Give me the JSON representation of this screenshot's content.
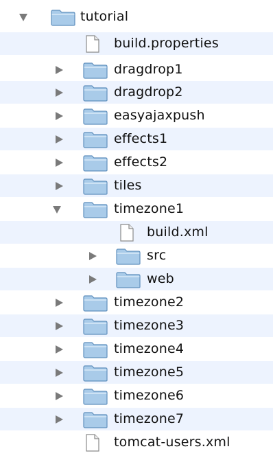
{
  "tree": {
    "root": {
      "name": "tutorial",
      "expanded": true,
      "icon": "folder-icon"
    },
    "items": [
      {
        "name": "build.properties",
        "type": "file",
        "icon": "document-icon"
      },
      {
        "name": "dragdrop1",
        "type": "folder",
        "expanded": false,
        "icon": "folder-icon"
      },
      {
        "name": "dragdrop2",
        "type": "folder",
        "expanded": false,
        "icon": "folder-icon"
      },
      {
        "name": "easyajaxpush",
        "type": "folder",
        "expanded": false,
        "icon": "folder-icon"
      },
      {
        "name": "effects1",
        "type": "folder",
        "expanded": false,
        "icon": "folder-icon"
      },
      {
        "name": "effects2",
        "type": "folder",
        "expanded": false,
        "icon": "folder-icon"
      },
      {
        "name": "tiles",
        "type": "folder",
        "expanded": false,
        "icon": "folder-icon"
      },
      {
        "name": "timezone1",
        "type": "folder",
        "expanded": true,
        "icon": "folder-icon",
        "children": [
          {
            "name": "build.xml",
            "type": "file",
            "icon": "document-icon"
          },
          {
            "name": "src",
            "type": "folder",
            "expanded": false,
            "icon": "folder-icon"
          },
          {
            "name": "web",
            "type": "folder",
            "expanded": false,
            "icon": "folder-icon"
          }
        ]
      },
      {
        "name": "timezone2",
        "type": "folder",
        "expanded": false,
        "icon": "folder-icon"
      },
      {
        "name": "timezone3",
        "type": "folder",
        "expanded": false,
        "icon": "folder-icon"
      },
      {
        "name": "timezone4",
        "type": "folder",
        "expanded": false,
        "icon": "folder-icon"
      },
      {
        "name": "timezone5",
        "type": "folder",
        "expanded": false,
        "icon": "folder-icon"
      },
      {
        "name": "timezone6",
        "type": "folder",
        "expanded": false,
        "icon": "folder-icon"
      },
      {
        "name": "timezone7",
        "type": "folder",
        "expanded": false,
        "icon": "folder-icon"
      },
      {
        "name": "tomcat-users.xml",
        "type": "file",
        "icon": "document-icon"
      }
    ]
  },
  "colors": {
    "row_stripe": "#edf3fe",
    "folder_body": "#a9cbe9",
    "folder_edge": "#5f8fbd",
    "disclosure_triangle": "#7a7a7a"
  }
}
